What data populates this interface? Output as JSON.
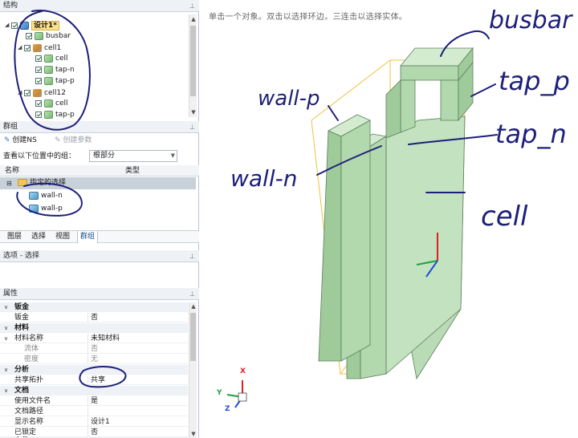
{
  "structure_panel": {
    "title": "结构",
    "items": [
      {
        "label": "设计1*"
      },
      {
        "label": "busbar"
      },
      {
        "label": "cell1"
      },
      {
        "label": "cell"
      },
      {
        "label": "tap-n"
      },
      {
        "label": "tap-p"
      },
      {
        "label": "cell12"
      },
      {
        "label": "cell"
      },
      {
        "label": "tap-p"
      }
    ]
  },
  "groups_panel": {
    "title": "群组",
    "create_ns": "创建NS",
    "create_param": "创建参数",
    "lookup_label": "查看以下位置中的组：",
    "lookup_value": "根部分",
    "col_name": "名称",
    "col_type": "类型",
    "group_header": "指定的选择",
    "items": [
      "wall-n",
      "wall-p"
    ]
  },
  "tabs": [
    "图层",
    "选择",
    "视图",
    "群组"
  ],
  "options_panel": {
    "title": "选项 - 选择"
  },
  "properties_panel": {
    "title": "属性",
    "rows": [
      {
        "kind": "cat",
        "key": "钣金"
      },
      {
        "kind": "row",
        "key": "钣金",
        "value": "否"
      },
      {
        "kind": "cat",
        "key": "材料"
      },
      {
        "kind": "row",
        "key": "材料名称",
        "value": "未知材料"
      },
      {
        "kind": "gray",
        "key": "流体",
        "value": "否"
      },
      {
        "kind": "gray",
        "key": "密度",
        "value": "无"
      },
      {
        "kind": "cat",
        "key": "分析"
      },
      {
        "kind": "row",
        "key": "共享拓扑",
        "value": "共享"
      },
      {
        "kind": "cat",
        "key": "文档"
      },
      {
        "kind": "row",
        "key": "使用文件名",
        "value": "是"
      },
      {
        "kind": "row",
        "key": "文档路径",
        "value": ""
      },
      {
        "kind": "row",
        "key": "显示名称",
        "value": "设计1"
      },
      {
        "kind": "row",
        "key": "已锁定",
        "value": "否"
      },
      {
        "kind": "cat",
        "key": "文件"
      }
    ]
  },
  "viewport": {
    "hint": "单击一个对象。双击以选择环边。三连击以选择实体。",
    "annotations": {
      "busbar": "busbar",
      "tap_p": "tap_p",
      "tap_n": "tap_n",
      "wall_p": "wall-p",
      "wall_n": "wall-n",
      "cell": "cell"
    },
    "triad": {
      "x": "X",
      "y": "Y",
      "z": "Z"
    }
  },
  "colors": {
    "model_face": "#b9dcb6",
    "model_dark": "#8fc08b",
    "bbox": "#f0c040",
    "ink": "#1d1f7a",
    "axis_x": "#e02020",
    "axis_y": "#20a040",
    "axis_z": "#2050d0"
  }
}
